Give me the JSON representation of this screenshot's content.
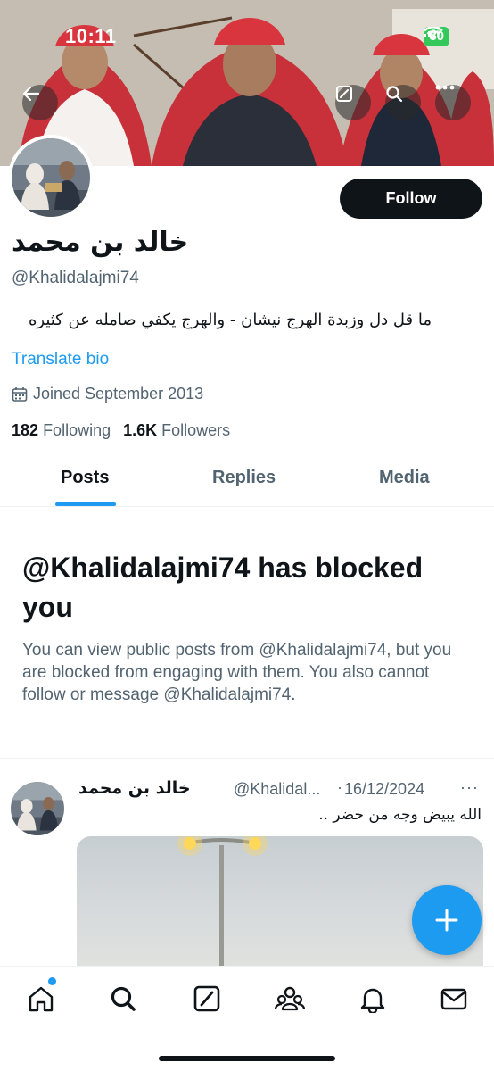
{
  "status_bar": {
    "time": "10:11",
    "battery": "80"
  },
  "profile": {
    "display_name": "خالد بن محمد",
    "handle": "@Khalidalajmi74",
    "bio": "ما قل دل وزبدة الهرج نيشان - والهرج يكفي صامله عن كثيره",
    "translate_label": "Translate bio",
    "joined": "Joined September 2013",
    "following_count": "182",
    "following_label": "Following",
    "followers_count": "1.6K",
    "followers_label": "Followers",
    "follow_button": "Follow"
  },
  "tabs": [
    {
      "label": "Posts",
      "active": true
    },
    {
      "label": "Replies",
      "active": false
    },
    {
      "label": "Media",
      "active": false
    }
  ],
  "blocked": {
    "title": "@Khalidalajmi74 has blocked you",
    "description": "You can view public posts from @Khalidalajmi74, but you are blocked from engaging with them. You also cannot follow or message @Khalidalajmi74."
  },
  "post": {
    "author_name": "خالد بن محمد",
    "author_handle": "@Khalidal...",
    "separator": "·",
    "date": "16/12/2024",
    "more": "···",
    "text": "الله يبيض وجه من حضر .."
  },
  "icons": {
    "back": "back-arrow-icon",
    "compose": "compose-icon",
    "search": "search-icon",
    "more": "more-icon",
    "calendar": "calendar-icon",
    "fab": "plus-icon",
    "nav": [
      "home-icon",
      "search-icon",
      "grok-icon",
      "communities-icon",
      "notifications-icon",
      "messages-icon"
    ]
  },
  "colors": {
    "accent": "#1d9bf0",
    "text": "#0f1419",
    "secondary": "#536471",
    "battery": "#34c759"
  }
}
